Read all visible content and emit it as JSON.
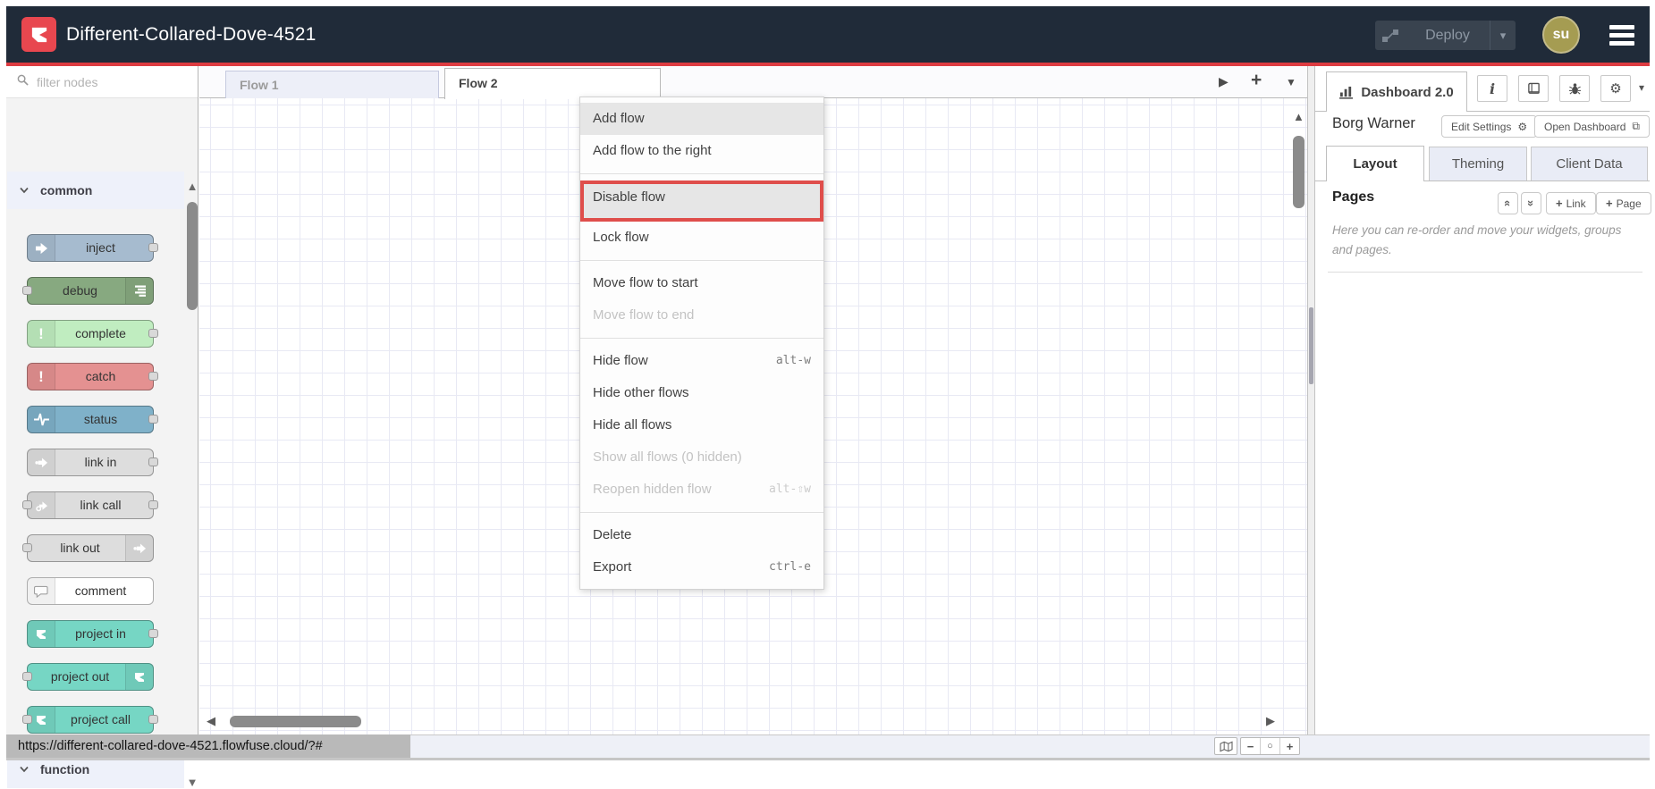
{
  "header": {
    "title": "Different-Collared-Dove-4521",
    "deploy_label": "Deploy",
    "avatar_initials": "su"
  },
  "palette": {
    "filter_placeholder": "filter nodes",
    "categories": [
      {
        "label": "common"
      },
      {
        "label": "function"
      }
    ],
    "nodes": [
      {
        "label": "inject",
        "color": "#a6bbcf",
        "icon": "inject-arrow-icon"
      },
      {
        "label": "debug",
        "color": "#87a980",
        "icon": "debug-lines-icon"
      },
      {
        "label": "complete",
        "color": "#c0edc0",
        "icon": "exclamation-icon"
      },
      {
        "label": "catch",
        "color": "#e49191",
        "icon": "exclamation-icon"
      },
      {
        "label": "status",
        "color": "#7fb1c9",
        "icon": "pulse-icon"
      },
      {
        "label": "link in",
        "color": "#dddddd",
        "icon": "link-arrow-icon"
      },
      {
        "label": "link call",
        "color": "#dddddd",
        "icon": "link-arrow-icon"
      },
      {
        "label": "link out",
        "color": "#dddddd",
        "icon": "link-arrow-icon"
      },
      {
        "label": "comment",
        "color": "#ffffff",
        "icon": "comment-bubble-icon"
      },
      {
        "label": "project in",
        "color": "#76d6c4",
        "icon": "project-logo-icon"
      },
      {
        "label": "project out",
        "color": "#76d6c4",
        "icon": "project-logo-icon"
      },
      {
        "label": "project call",
        "color": "#76d6c4",
        "icon": "project-logo-icon"
      }
    ]
  },
  "workspace": {
    "tabs": [
      {
        "label": "Flow 1",
        "active": false
      },
      {
        "label": "Flow 2",
        "active": true
      }
    ]
  },
  "context_menu": {
    "items": [
      {
        "label": "Add flow",
        "hovered": true
      },
      {
        "label": "Add flow to the right"
      },
      {
        "label": "Disable flow",
        "highlighted": true
      },
      {
        "label": "Lock flow"
      },
      {
        "label": "Move flow to start"
      },
      {
        "label": "Move flow to end",
        "disabled": true
      },
      {
        "label": "Hide flow",
        "shortcut": "alt-w"
      },
      {
        "label": "Hide other flows"
      },
      {
        "label": "Hide all flows"
      },
      {
        "label": "Show all flows (0 hidden)",
        "disabled": true
      },
      {
        "label": "Reopen hidden flow",
        "shortcut": "alt-⇧w",
        "disabled": true
      },
      {
        "label": "Delete"
      },
      {
        "label": "Export",
        "shortcut": "ctrl-e"
      }
    ]
  },
  "sidebar": {
    "tool_tab": "Dashboard 2.0",
    "instance_name": "Borg Warner",
    "edit_settings_label": "Edit Settings",
    "open_dashboard_label": "Open Dashboard",
    "tabs": [
      {
        "label": "Layout",
        "active": true
      },
      {
        "label": "Theming",
        "active": false
      },
      {
        "label": "Client Data",
        "active": false
      }
    ],
    "pages": {
      "title": "Pages",
      "link_button": "Link",
      "page_button": "Page",
      "help_text": "Here you can re-order and move your widgets, groups and pages."
    }
  },
  "status_bar": {
    "url": "https://different-collared-dove-4521.flowfuse.cloud/?#"
  },
  "icons": {
    "caret_down": "▾",
    "tab_run": "▶",
    "tab_add": "+",
    "tab_list_caret": "▼",
    "scroll_up": "▲",
    "scroll_down": "▼",
    "scroll_left": "◀",
    "scroll_right": "▶",
    "chevrons_collapse": "«",
    "chevrons_expand": "»",
    "zoom_out": "−",
    "zoom_reset": "○",
    "zoom_in": "+",
    "gear": "⚙",
    "external_link": "⧉",
    "exclamation": "!",
    "info": "i",
    "plus": "+"
  },
  "colors": {
    "header_bg": "#202b39",
    "accent_red": "#dd3b41",
    "logo_red": "#e8474f",
    "avatar_olive": "#a59c52",
    "inactive_tab_bg": "#edeff8",
    "menu_highlight_border": "#df4e4b",
    "grid_line": "#e8e9f4"
  }
}
